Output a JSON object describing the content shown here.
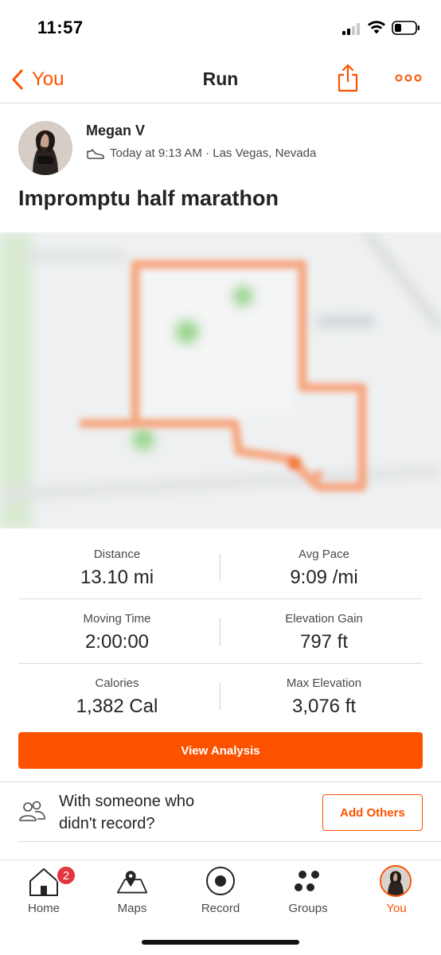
{
  "status_bar": {
    "time": "11:57"
  },
  "nav": {
    "back_label": "You",
    "title": "Run",
    "share_icon": "share-icon",
    "more_icon": "more-icon"
  },
  "activity": {
    "athlete_name": "Megan V",
    "meta": "Today at 9:13 AM · Las Vegas, Nevada",
    "title": "Impromptu half marathon"
  },
  "stats": [
    {
      "left_label": "Distance",
      "left_value": "13.10 mi",
      "right_label": "Avg Pace",
      "right_value": "9:09 /mi"
    },
    {
      "left_label": "Moving Time",
      "left_value": "2:00:00",
      "right_label": "Elevation Gain",
      "right_value": "797 ft"
    },
    {
      "left_label": "Calories",
      "left_value": "1,382 Cal",
      "right_label": "Max Elevation",
      "right_value": "3,076 ft"
    }
  ],
  "view_analysis_label": "View Analysis",
  "with_others": {
    "text": "With someone who didn't record?",
    "button_label": "Add Others"
  },
  "tabs": [
    {
      "label": "Home",
      "icon": "home-icon",
      "badge": "2"
    },
    {
      "label": "Maps",
      "icon": "map-icon"
    },
    {
      "label": "Record",
      "icon": "record-icon"
    },
    {
      "label": "Groups",
      "icon": "groups-icon"
    },
    {
      "label": "You",
      "icon": "profile-avatar",
      "active": true
    }
  ],
  "colors": {
    "accent": "#fc5200",
    "text": "#242428",
    "badge": "#e2353d"
  }
}
